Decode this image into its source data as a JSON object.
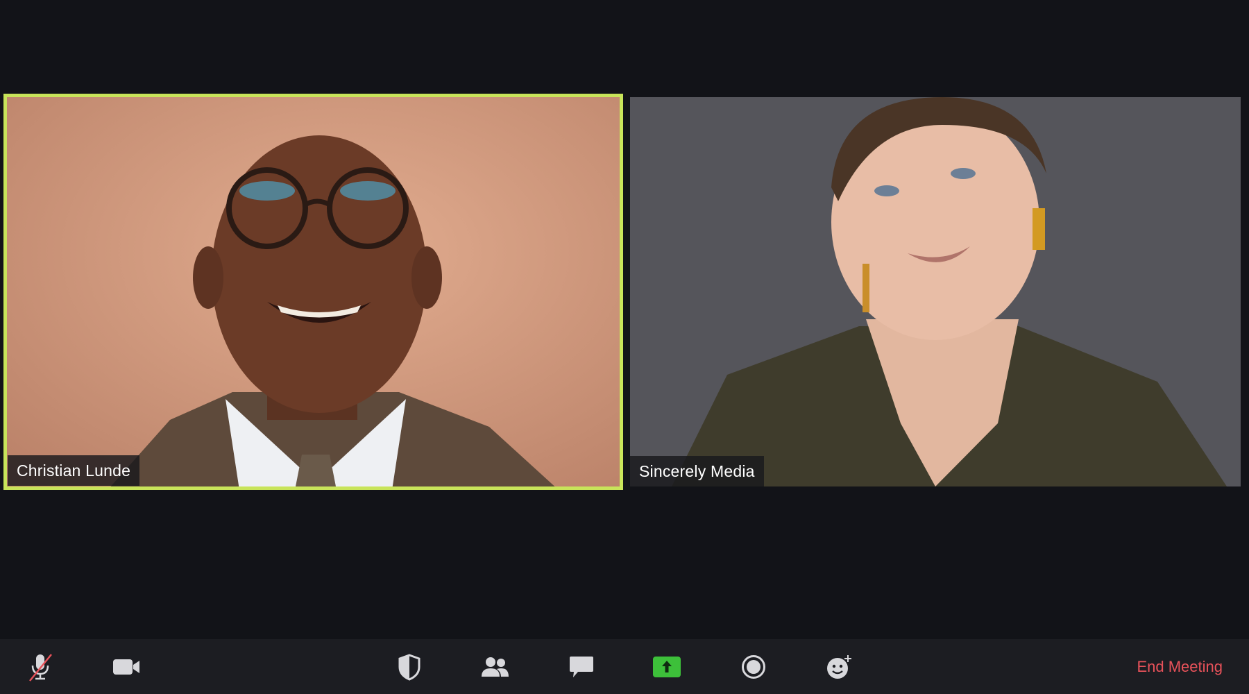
{
  "participants": [
    {
      "name": "Christian Lunde",
      "active_speaker": true
    },
    {
      "name": "Sincerely Media",
      "active_speaker": false
    }
  ],
  "colors": {
    "active_speaker_border": "#c8e45a",
    "share_screen_green": "#3dc03a",
    "end_meeting_red": "#e8525a",
    "mute_slash_red": "#e8525a"
  },
  "toolbar": {
    "buttons": [
      {
        "id": "microphone",
        "icon": "microphone-muted-icon",
        "state": "muted"
      },
      {
        "id": "video",
        "icon": "video-camera-icon"
      },
      {
        "id": "security",
        "icon": "shield-icon"
      },
      {
        "id": "participants",
        "icon": "people-icon"
      },
      {
        "id": "chat",
        "icon": "chat-bubble-icon"
      },
      {
        "id": "share-screen",
        "icon": "share-screen-arrow-icon"
      },
      {
        "id": "record",
        "icon": "record-icon"
      },
      {
        "id": "reactions",
        "icon": "emoji-add-icon"
      }
    ],
    "end_meeting_label": "End Meeting"
  }
}
